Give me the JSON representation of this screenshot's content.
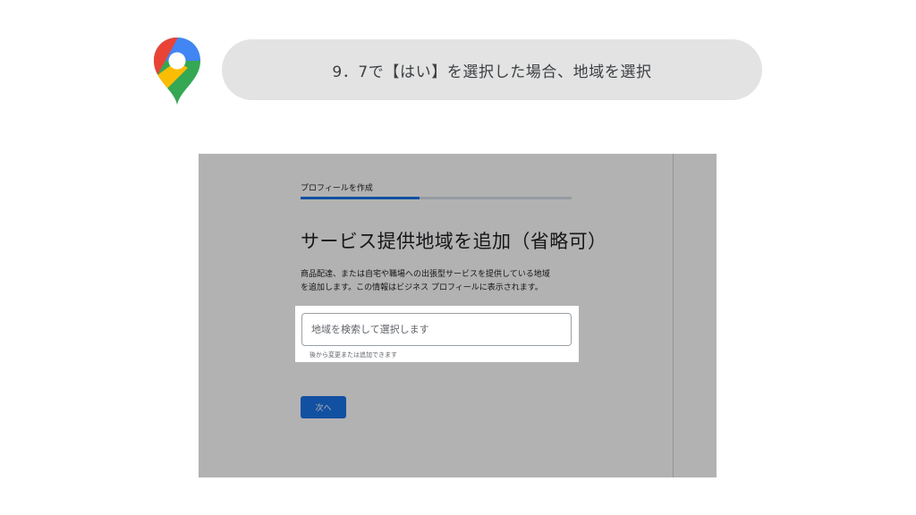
{
  "step": {
    "caption": "9．7で【はい】を選択した場合、地域を選択"
  },
  "logo": {
    "icon": "google-maps-pin-icon",
    "colors": {
      "blue": "#4285F4",
      "red": "#EA4335",
      "yellow": "#FBBC04",
      "green": "#34A853"
    }
  },
  "screen": {
    "header": "プロフィールを作成",
    "progress_fraction": 0.44,
    "title": "サービス提供地域を追加（省略可）",
    "description_lines": [
      "商品配達、または自宅や職場への出張型サービスを提供している地域",
      "を追加します。この情報はビジネス プロフィールに表示されます。"
    ],
    "search": {
      "placeholder": "地域を検索して選択します",
      "value": ""
    },
    "helper_text": "後から変更または追加できます",
    "next_button": "次へ",
    "colors": {
      "accent": "#1A73E8",
      "overlay": "rgba(0,0,0,0.30)"
    }
  }
}
